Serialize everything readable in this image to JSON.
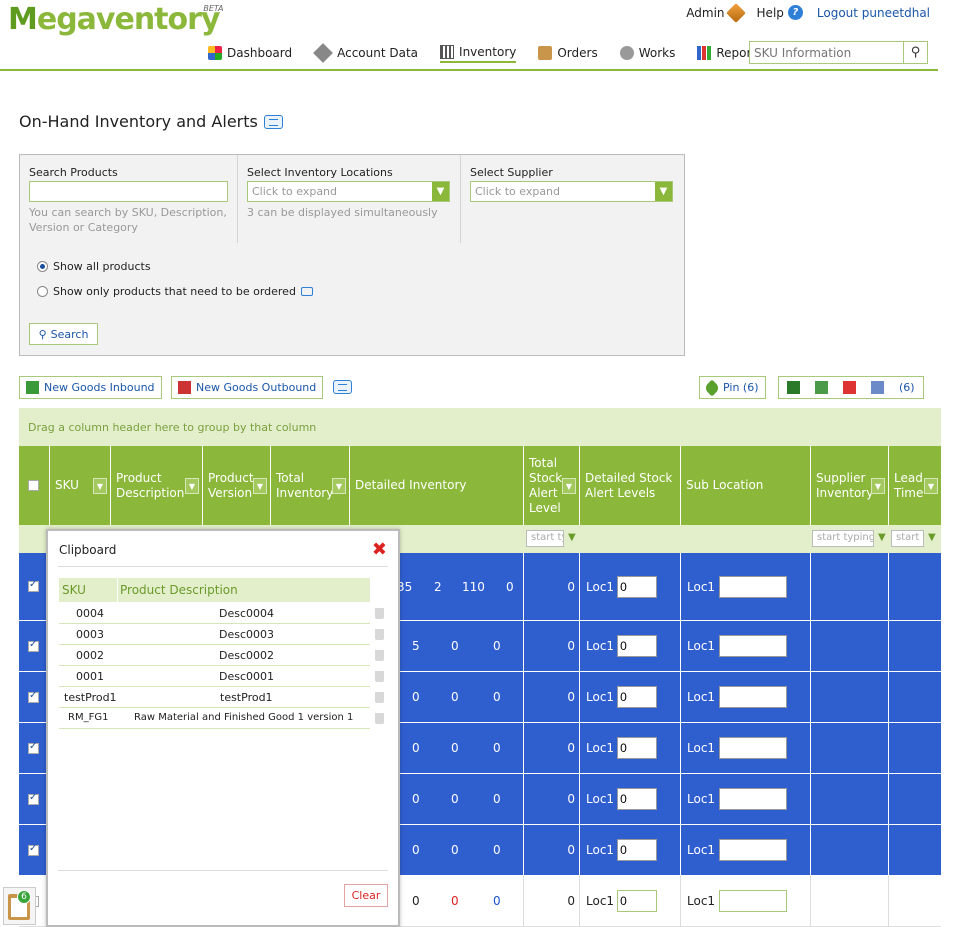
{
  "header": {
    "logo_text": "egaventory",
    "logo_m": "M",
    "logo_beta": "BETA",
    "admin": "Admin",
    "help": "Help",
    "logout": "Logout puneetdhal"
  },
  "nav": {
    "dashboard": "Dashboard",
    "account_data": "Account Data",
    "inventory": "Inventory",
    "orders": "Orders",
    "works": "Works",
    "reports": "Reports",
    "search_placeholder": "SKU Information"
  },
  "page": {
    "title": "On-Hand Inventory and Alerts"
  },
  "search_panel": {
    "products_label": "Search Products",
    "products_hint": "You can search by SKU, Description, Version or Category",
    "locations_label": "Select Inventory Locations",
    "locations_value": "Click to expand",
    "locations_hint": "3 can be displayed simultaneously",
    "supplier_label": "Select Supplier",
    "supplier_value": "Click to expand",
    "radio_all": "Show all products",
    "radio_order": "Show only products that need to be ordered",
    "search_button": "Search"
  },
  "actions": {
    "inbound": "New Goods Inbound",
    "outbound": "New Goods Outbound",
    "pin": "Pin (6)",
    "export_count": "(6)"
  },
  "grid": {
    "group_hint": "Drag a column header here to group by that column",
    "headers": {
      "sku": "SKU",
      "product_description": "Product Description",
      "product_version": "Product Version",
      "total_inventory": "Total Inventory",
      "detailed_inventory": "Detailed Inventory",
      "total_stock_alert": "Total Stock Alert Level",
      "detailed_stock_alert": "Detailed Stock Alert Levels",
      "sub_location": "Sub Location",
      "supplier_inventory": "Supplier Inventory",
      "lead_time": "Lead Time"
    },
    "filter_placeholder_short": "start ty",
    "filter_placeholder": "start typing",
    "filter_placeholder_tiny": "start t",
    "loc_label": "Loc1",
    "rows": [
      {
        "d1": "35",
        "d2": "2",
        "d3": "110",
        "d4": "0",
        "alert": "0",
        "loc_val": "0",
        "selected": true
      },
      {
        "d1": "5",
        "d2": "0",
        "d3": "0",
        "d4": "",
        "alert": "0",
        "loc_val": "0",
        "selected": true
      },
      {
        "d1": "0",
        "d2": "0",
        "d3": "0",
        "d4": "",
        "alert": "0",
        "loc_val": "0",
        "selected": true
      },
      {
        "d1": "0",
        "d2": "0",
        "d3": "0",
        "d4": "",
        "alert": "0",
        "loc_val": "0",
        "selected": true
      },
      {
        "d1": "0",
        "d2": "0",
        "d3": "0",
        "d4": "",
        "alert": "0",
        "loc_val": "0",
        "selected": true
      },
      {
        "d1": "0",
        "d2": "0",
        "d3": "0",
        "d4": "",
        "alert": "0",
        "loc_val": "0",
        "selected": true
      },
      {
        "d1": "0",
        "d2": "0",
        "d3": "0",
        "d4": "",
        "alert": "0",
        "loc_val": "0",
        "selected": false
      }
    ]
  },
  "clipboard": {
    "title": "Clipboard",
    "col_sku": "SKU",
    "col_desc": "Product Description",
    "items": [
      {
        "sku": "0004",
        "desc": "Desc0004"
      },
      {
        "sku": "0003",
        "desc": "Desc0003"
      },
      {
        "sku": "0002",
        "desc": "Desc0002"
      },
      {
        "sku": "0001",
        "desc": "Desc0001"
      },
      {
        "sku": "testProd1",
        "desc": "testProd1"
      },
      {
        "sku": "RM_FG1",
        "desc": "Raw Material and Finished Good 1 version 1"
      }
    ],
    "clear": "Clear",
    "badge_count": "6"
  },
  "colors": {
    "accent": "#8bb83a",
    "row_selected": "#2f5ecf",
    "link": "#1a55a8",
    "red_value": "#d22",
    "blue_value": "#1a4fd0"
  }
}
